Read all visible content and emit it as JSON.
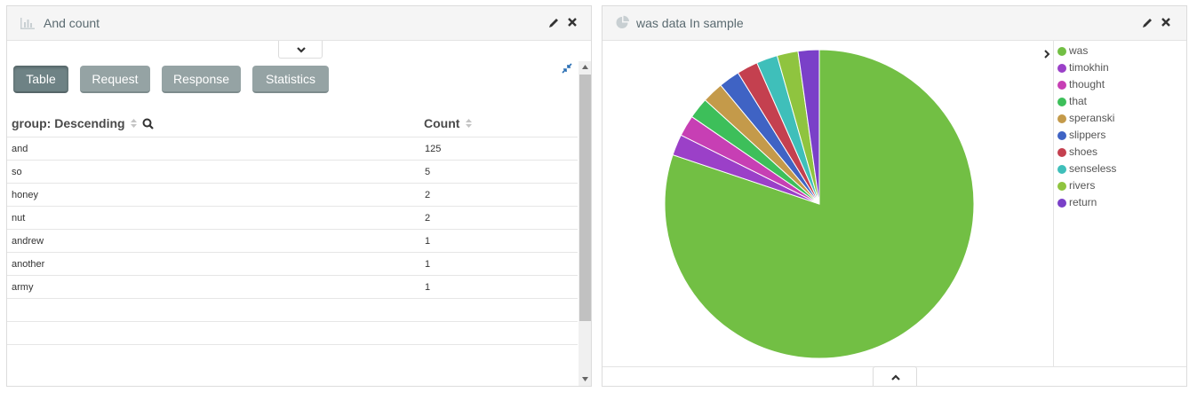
{
  "left_panel": {
    "title": "And count",
    "tabs": [
      {
        "label": "Table",
        "active": true
      },
      {
        "label": "Request",
        "active": false
      },
      {
        "label": "Response",
        "active": false
      },
      {
        "label": "Statistics",
        "active": false
      }
    ],
    "table": {
      "columns": [
        "group: Descending",
        "Count"
      ],
      "rows": [
        {
          "group": "and",
          "count": "125"
        },
        {
          "group": "so",
          "count": "5"
        },
        {
          "group": "honey",
          "count": "2"
        },
        {
          "group": "nut",
          "count": "2"
        },
        {
          "group": "andrew",
          "count": "1"
        },
        {
          "group": "another",
          "count": "1"
        },
        {
          "group": "army",
          "count": "1"
        }
      ]
    }
  },
  "right_panel": {
    "title": "was data In sample"
  },
  "chart_data": {
    "type": "pie",
    "title": "was data In sample",
    "labels": [
      "was",
      "timokhin",
      "thought",
      "that",
      "speranski",
      "slippers",
      "shoes",
      "senseless",
      "rivers",
      "return"
    ],
    "values": [
      80.0,
      2.2,
      2.2,
      2.2,
      2.2,
      2.2,
      2.2,
      2.2,
      2.2,
      2.2
    ],
    "colors": [
      "#72bf44",
      "#9b40c8",
      "#c73fb4",
      "#3dbf5a",
      "#c49a4a",
      "#3f63c4",
      "#c4404f",
      "#3fbfba",
      "#8fc43f",
      "#7a40c8"
    ],
    "legend_position": "right"
  }
}
